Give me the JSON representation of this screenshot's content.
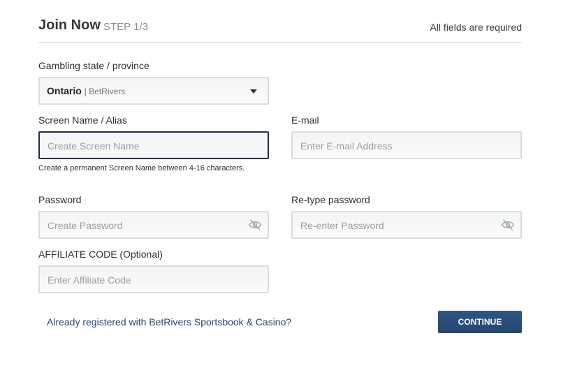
{
  "header": {
    "title": "Join Now",
    "step": "STEP 1/3",
    "required_note": "All fields are required"
  },
  "state": {
    "label": "Gambling state / province",
    "selected": "Ontario",
    "selected_sub": "| BetRivers"
  },
  "screen_name": {
    "label": "Screen Name / Alias",
    "placeholder": "Create Screen Name",
    "hint": "Create a permanent Screen Name between 4-16 characters."
  },
  "email": {
    "label": "E-mail",
    "placeholder": "Enter E-mail Address"
  },
  "password": {
    "label": "Password",
    "placeholder": "Create Password"
  },
  "retype_password": {
    "label": "Re-type password",
    "placeholder": "Re-enter Password"
  },
  "affiliate": {
    "label": "AFFILIATE CODE (Optional)",
    "placeholder": "Enter Affiliate Code"
  },
  "footer": {
    "login_link": "Already registered with BetRivers Sportsbook & Casino?",
    "continue_label": "CONTINUE"
  },
  "icons": {
    "caret": "chevron-down-icon",
    "password_toggle": "eye-slash-icon"
  },
  "colors": {
    "primary_button": "#2a4f7c",
    "focus_border": "#1f2f49",
    "link": "#26476e"
  }
}
